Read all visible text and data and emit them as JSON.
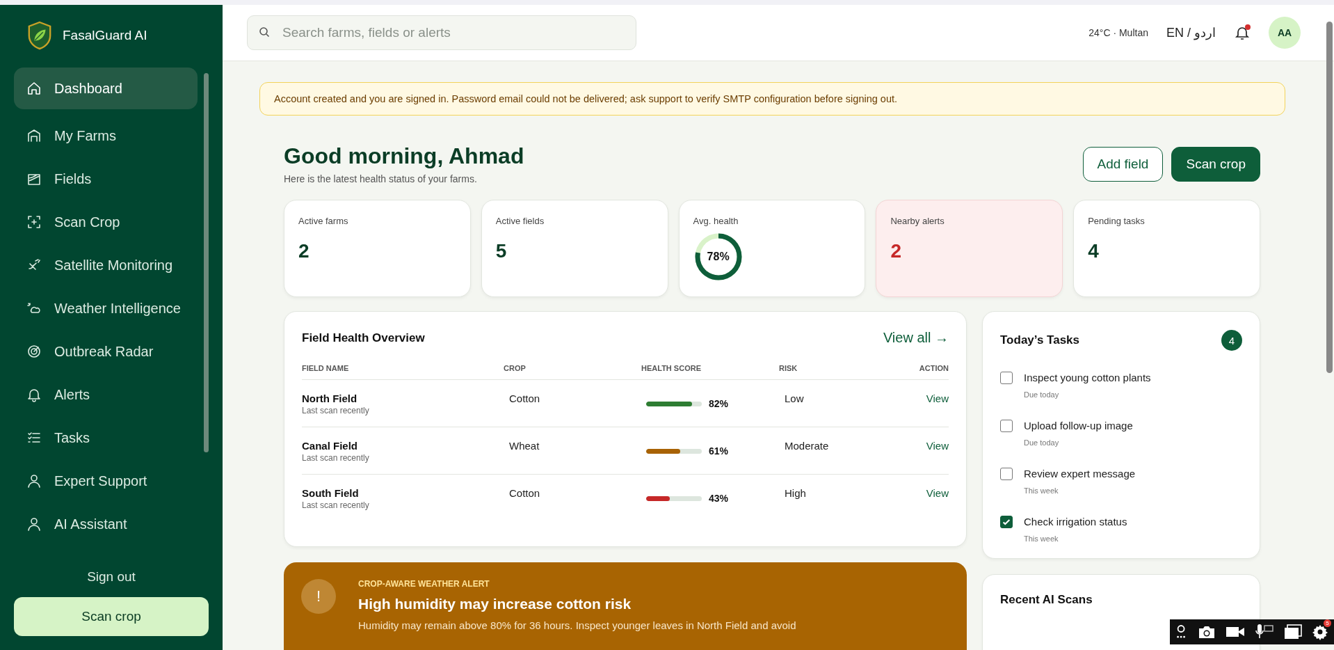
{
  "brand": {
    "name": "FasalGuard AI"
  },
  "nav": [
    {
      "label": "Dashboard",
      "selected": true
    },
    {
      "label": "My Farms",
      "selected": false
    },
    {
      "label": "Fields",
      "selected": false
    },
    {
      "label": "Scan Crop",
      "selected": false
    },
    {
      "label": "Satellite Monitoring",
      "selected": false
    },
    {
      "label": "Weather Intelligence",
      "selected": false
    },
    {
      "label": "Outbreak Radar",
      "selected": false
    },
    {
      "label": "Alerts",
      "selected": false
    },
    {
      "label": "Tasks",
      "selected": false
    },
    {
      "label": "Expert Support",
      "selected": false
    },
    {
      "label": "AI Assistant",
      "selected": false
    }
  ],
  "sidebar_footer": {
    "sign_out": "Sign out",
    "scan_button": "Scan crop"
  },
  "topbar": {
    "search_placeholder": "Search farms, fields or alerts",
    "weather": "24°C · Multan",
    "language": "EN / اردو",
    "notification_dot": true,
    "avatar": "AA"
  },
  "notice": "Account created and you are signed in. Password email could not be delivered; ask support to verify SMTP configuration before signing out.",
  "greeting": {
    "title": "Good morning, Ahmad",
    "subtitle": "Here is the latest health status of your farms."
  },
  "actions": [
    {
      "label": "Add field",
      "kind": "outline"
    },
    {
      "label": "Scan crop",
      "kind": "primary"
    }
  ],
  "stats": [
    {
      "label": "Active farms",
      "value": "2",
      "kind": "number"
    },
    {
      "label": "Active fields",
      "value": "5",
      "kind": "number"
    },
    {
      "label": "Avg. health",
      "value": "78%",
      "kind": "ring",
      "level": 0.78
    },
    {
      "label": "Nearby alerts",
      "value": "2",
      "kind": "alert"
    },
    {
      "label": "Pending tasks",
      "value": "4",
      "kind": "number"
    }
  ],
  "field_health": {
    "title": "Field Health Overview",
    "link": "View all →",
    "columns": [
      "FIELD NAME",
      "CROP",
      "HEALTH SCORE",
      "RISK",
      "ACTION"
    ],
    "rows": [
      {
        "name": "North Field",
        "sub": "Last scan recently",
        "crop": "Cotton",
        "level": 0.82,
        "score": "82%",
        "color": "#2e7d32",
        "risk": "Low",
        "action": "View"
      },
      {
        "name": "Canal Field",
        "sub": "Last scan recently",
        "crop": "Wheat",
        "level": 0.61,
        "score": "61%",
        "color": "#a86205",
        "risk": "Moderate",
        "action": "View"
      },
      {
        "name": "South Field",
        "sub": "Last scan recently",
        "crop": "Cotton",
        "level": 0.43,
        "score": "43%",
        "color": "#c62828",
        "risk": "High",
        "action": "View"
      }
    ]
  },
  "weather_alert": {
    "icon": "!",
    "eyebrow": "CROP-AWARE WEATHER ALERT",
    "title": "High humidity may increase cotton risk",
    "body": "Humidity may remain above 80% for 36 hours. Inspect younger leaves in North Field and avoid"
  },
  "tasks": {
    "title": "Today’s Tasks",
    "count": "4",
    "items": [
      {
        "label": "Inspect young cotton plants",
        "due": "Due today",
        "checked": false
      },
      {
        "label": "Upload follow-up image",
        "due": "Due today",
        "checked": false
      },
      {
        "label": "Review expert message",
        "due": "This week",
        "checked": false
      },
      {
        "label": "Check irrigation status",
        "due": "This week",
        "checked": true
      }
    ]
  },
  "recent_scans": {
    "title": "Recent AI Scans"
  },
  "recorder_toolbar": {
    "badge": "5"
  }
}
